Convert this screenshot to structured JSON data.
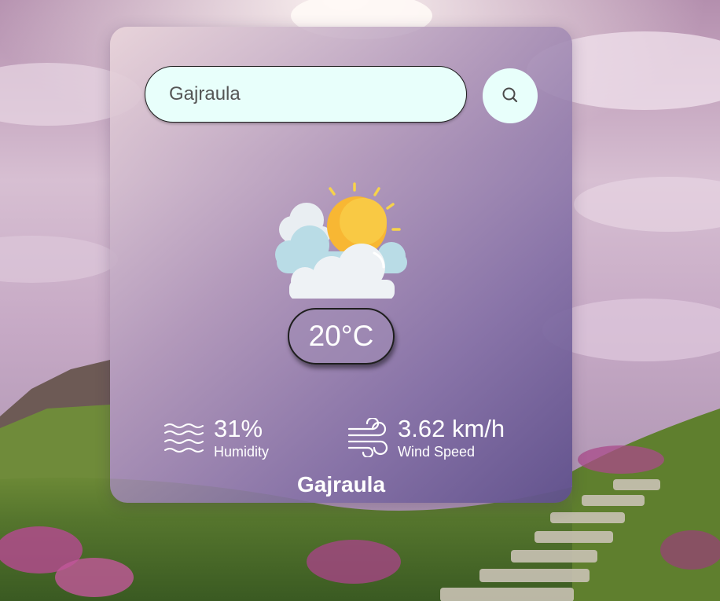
{
  "search": {
    "value": "Gajraula",
    "icon": "search-icon"
  },
  "weather": {
    "condition_icon": "sun-behind-clouds-icon",
    "temperature": "20°C"
  },
  "humidity": {
    "value": "31%",
    "label": "Humidity",
    "icon": "humidity-waves-icon"
  },
  "wind": {
    "value": "3.62 km/h",
    "label": "Wind Speed",
    "icon": "wind-icon"
  },
  "city": "Gajraula",
  "colors": {
    "input_bg": "#e8fffb",
    "text": "#ffffff",
    "sun": "#f8b733",
    "cloud": "#eef2f5"
  }
}
